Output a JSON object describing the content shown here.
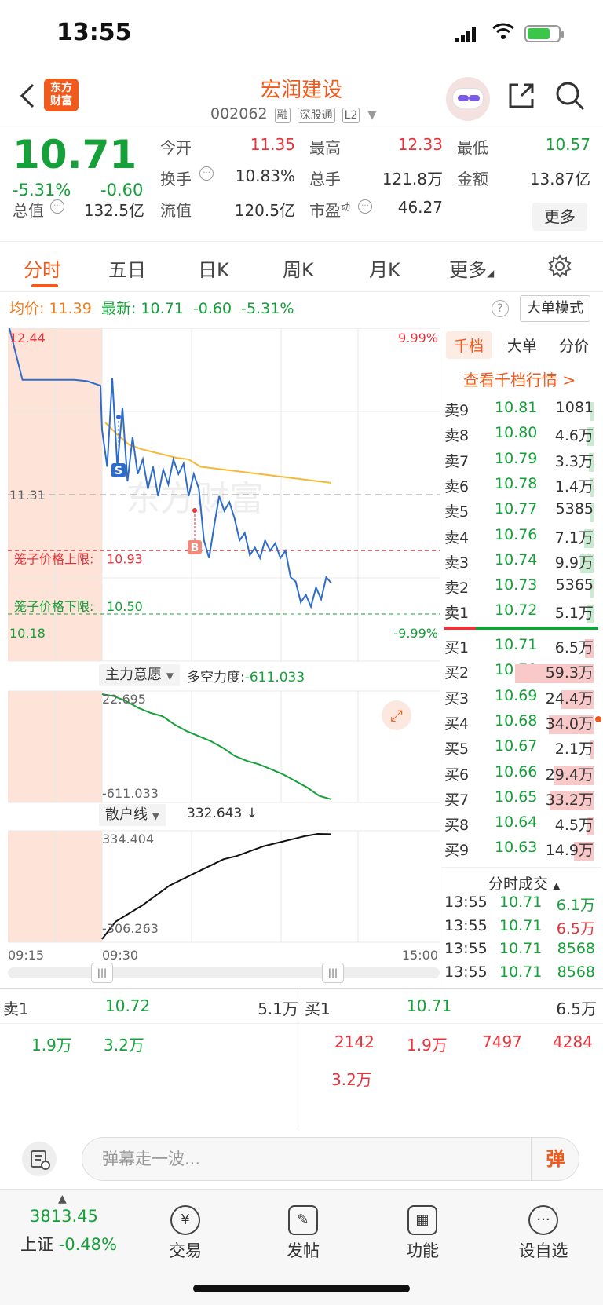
{
  "status": {
    "time": "13:55"
  },
  "stock": {
    "name": "宏润建设",
    "code": "002062",
    "tags": [
      "融",
      "深股通",
      "L2"
    ],
    "price": "10.71",
    "pct": "-5.31%",
    "change": "-0.60",
    "market_cap_label": "总值",
    "market_cap": "132.5亿",
    "quotes": [
      {
        "label": "今开",
        "value": "11.35",
        "color": "#e8333a"
      },
      {
        "label": "最高",
        "value": "12.33",
        "color": "#e8333a"
      },
      {
        "label": "最低",
        "value": "10.57",
        "color": "#16a03a"
      },
      {
        "label": "换手",
        "value": "10.83%",
        "color": "#333333"
      },
      {
        "label": "总手",
        "value": "121.8万",
        "color": "#333333"
      },
      {
        "label": "金额",
        "value": "13.87亿",
        "color": "#333333"
      },
      {
        "label": "流值",
        "value": "120.5亿",
        "color": "#333333"
      },
      {
        "label": "市盈",
        "value": "46.27",
        "color": "#333333"
      }
    ],
    "pe_sup": "动",
    "more": "更多"
  },
  "tabs": [
    "分时",
    "五日",
    "日K",
    "周K",
    "月K",
    "更多"
  ],
  "info_line": {
    "avg_label": "均价:",
    "avg": "11.39",
    "latest_label": "最新:",
    "latest": "10.71",
    "change": "-0.60",
    "pct": "-5.31%",
    "help": "?",
    "mode_btn": "大单模式"
  },
  "chart_data": {
    "type": "line",
    "title": "",
    "y_top_label": "12.44",
    "y_bottom_label": "10.18",
    "pct_top": "9.99%",
    "pct_bottom": "-9.99%",
    "prev_close_label": "11.31",
    "ylim": [
      10.18,
      12.44
    ],
    "prev_close": 11.31,
    "x_start": "09:15",
    "x_open": "09:30",
    "x_end": "15:00",
    "upper_limit_label": "笼子价格上限:",
    "upper_limit": "10.93",
    "lower_limit_label": "笼子价格下限:",
    "lower_limit": "10.50",
    "markers": [
      {
        "label": "S"
      },
      {
        "label": "B"
      }
    ],
    "watermark": "东方财富",
    "price_series": [
      12.44,
      12.09,
      12.09,
      12.09,
      12.09,
      12.09,
      12.08,
      12.05,
      11.75,
      11.5,
      12.1,
      11.5,
      11.9,
      11.4,
      11.7,
      11.45,
      11.55,
      11.35,
      11.5,
      11.3,
      11.48,
      11.38,
      11.55,
      11.45,
      11.52,
      11.3,
      11.45,
      11.35,
      11.0,
      10.88,
      11.1,
      11.3,
      11.2,
      11.26,
      11.15,
      11.0,
      11.05,
      10.9,
      10.95,
      10.88,
      11.0,
      10.93,
      10.98,
      10.88,
      10.93,
      10.75,
      10.72,
      10.58,
      10.63,
      10.55,
      10.68,
      10.6,
      10.75,
      10.71
    ],
    "avg_series": [
      11.8,
      11.72,
      11.65,
      11.62,
      11.6,
      11.58,
      11.56,
      11.55,
      11.5,
      11.49,
      11.48,
      11.47,
      11.46,
      11.45,
      11.44,
      11.43,
      11.42,
      11.41,
      11.4,
      11.39
    ],
    "sub1": {
      "label": "主力意愿",
      "title": "多空力度:",
      "value": "-611.033",
      "top_label": "22.695",
      "bottom_label": "-611.033",
      "ylim": [
        -611.033,
        22.695
      ]
    },
    "sub2": {
      "label": "散户线",
      "value": "332.643",
      "arrow": "↓",
      "top_label": "334.404",
      "bottom_label": "-306.263",
      "ylim": [
        -306.263,
        334.404
      ]
    },
    "sub1_series": [
      22.695,
      10,
      -20,
      -60,
      -90,
      -110,
      -160,
      -200,
      -230,
      -260,
      -300,
      -350,
      -380,
      -400,
      -430,
      -460,
      -500,
      -540,
      -590,
      -611.033
    ],
    "sub2_series": [
      -306.263,
      -200,
      -150,
      -100,
      -40,
      20,
      60,
      100,
      140,
      180,
      200,
      230,
      260,
      280,
      300,
      320,
      334.404,
      332.643
    ]
  },
  "orderbook": {
    "tabs": [
      "千档",
      "大单",
      "分价"
    ],
    "link": "查看千档行情 >",
    "asks": [
      {
        "label": "卖9",
        "price": "10.81",
        "vol": "1081",
        "level": 0.03
      },
      {
        "label": "卖8",
        "price": "10.80",
        "vol": "4.6万",
        "level": 0.08
      },
      {
        "label": "卖7",
        "price": "10.79",
        "vol": "3.3万",
        "level": 0.06
      },
      {
        "label": "卖6",
        "price": "10.78",
        "vol": "1.4万",
        "level": 0.03
      },
      {
        "label": "卖5",
        "price": "10.77",
        "vol": "5385",
        "level": 0.02
      },
      {
        "label": "卖4",
        "price": "10.76",
        "vol": "7.1万",
        "level": 0.12
      },
      {
        "label": "卖3",
        "price": "10.74",
        "vol": "9.9万",
        "level": 0.17
      },
      {
        "label": "卖2",
        "price": "10.73",
        "vol": "5365",
        "level": 0.02
      },
      {
        "label": "卖1",
        "price": "10.72",
        "vol": "5.1万",
        "level": 0.09
      }
    ],
    "bids": [
      {
        "label": "买1",
        "price": "10.71",
        "vol": "6.5万",
        "level": 0.11
      },
      {
        "label": "买2",
        "price": "10.70",
        "vol": "59.3万",
        "level": 1.0
      },
      {
        "label": "买3",
        "price": "10.69",
        "vol": "24.4万",
        "level": 0.41
      },
      {
        "label": "买4",
        "price": "10.68",
        "vol": "34.0万",
        "level": 0.57
      },
      {
        "label": "买5",
        "price": "10.67",
        "vol": "2.1万",
        "level": 0.04
      },
      {
        "label": "买6",
        "price": "10.66",
        "vol": "29.4万",
        "level": 0.5
      },
      {
        "label": "买7",
        "price": "10.65",
        "vol": "33.2万",
        "level": 0.56
      },
      {
        "label": "买8",
        "price": "10.64",
        "vol": "4.5万",
        "level": 0.08
      },
      {
        "label": "买9",
        "price": "10.63",
        "vol": "14.9万",
        "level": 0.25
      }
    ],
    "fs_title": "分时成交",
    "fs_rows": [
      {
        "time": "13:55",
        "price": "10.71",
        "vol": "6.1万",
        "color": "#16a03a"
      },
      {
        "time": "13:55",
        "price": "10.71",
        "vol": "6.5万",
        "color": "#e8333a"
      },
      {
        "time": "13:55",
        "price": "10.71",
        "vol": "8568",
        "color": "#16a03a"
      },
      {
        "time": "13:55",
        "price": "10.71",
        "vol": "8568",
        "color": "#16a03a"
      }
    ]
  },
  "bottom_quote": {
    "ask_label": "卖1",
    "ask_price": "10.72",
    "ask_vol": "5.1万",
    "bid_label": "买1",
    "bid_price": "10.71",
    "bid_vol": "6.5万",
    "ask_details": [
      "1.9万",
      "3.2万"
    ],
    "bid_details": [
      "2142",
      "1.9万",
      "7497",
      "4284",
      "3.2万"
    ]
  },
  "comment": {
    "placeholder": "弹幕走一波...",
    "btn": "弹"
  },
  "tabbar": {
    "index_value": "3813.45",
    "index_name": "上证",
    "index_pct": "-0.48%",
    "items": [
      {
        "label": "交易",
        "icon": "yen-icon"
      },
      {
        "label": "发帖",
        "icon": "edit-icon"
      },
      {
        "label": "功能",
        "icon": "grid-icon"
      },
      {
        "label": "设自选",
        "icon": "more-icon"
      }
    ]
  },
  "colors": {
    "up": "#e8333a",
    "down": "#16a03a",
    "brand": "#f05a1c",
    "line": "#2f6cc8",
    "avg": "#f5b93a"
  }
}
